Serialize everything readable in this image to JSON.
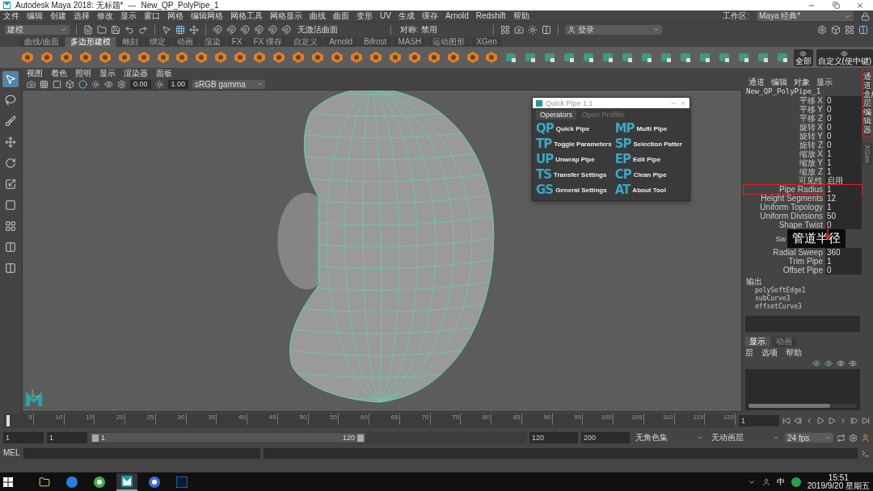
{
  "title_bar": {
    "app_title": "Autodesk Maya 2018: 无标题*",
    "separator": "---",
    "scene": "New_QP_PolyPipe_1"
  },
  "menu_bar": {
    "items": [
      "文件",
      "编辑",
      "创建",
      "选择",
      "修改",
      "显示",
      "窗口",
      "网格",
      "编辑网格",
      "网格工具",
      "网格显示",
      "曲线",
      "曲面",
      "变形",
      "UV",
      "生成",
      "缓存",
      "Arnold",
      "Redshift",
      "帮助"
    ],
    "workspace_label": "工作区:",
    "workspace": "Maya 经典*"
  },
  "status_line": {
    "mode": "建模",
    "surface": "无激活曲面",
    "symmetry": "对称: 禁用",
    "login": "登录"
  },
  "shelf": {
    "tabs": [
      {
        "label": "曲线/曲面",
        "selected": false
      },
      {
        "label": "多边形建模",
        "selected": true
      },
      {
        "label": "雕刻",
        "selected": false
      },
      {
        "label": "绑定",
        "selected": false
      },
      {
        "label": "动画",
        "selected": false
      },
      {
        "label": "渲染",
        "selected": false
      },
      {
        "label": "FX",
        "selected": false
      },
      {
        "label": "FX 缓存",
        "selected": false
      },
      {
        "label": "自定义",
        "selected": false
      },
      {
        "label": "Arnold",
        "selected": false
      },
      {
        "label": "Bifrost",
        "selected": false
      },
      {
        "label": "MASH",
        "selected": false
      },
      {
        "label": "运动图形",
        "selected": false
      },
      {
        "label": "XGen",
        "selected": false
      }
    ],
    "labeled_tools": [
      "全部",
      "自定义(使中键)"
    ]
  },
  "viewport": {
    "menu": [
      "视图",
      "着色",
      "照明",
      "显示",
      "渲染器",
      "面板"
    ],
    "exposure": "0.00",
    "gamma": "1.00",
    "color_space": "sRGB gamma"
  },
  "quick_pipe": {
    "title": "Quick Pipe 1.1",
    "tabs": [
      {
        "label": "Operators",
        "selected": true
      },
      {
        "label": "Open Profiler",
        "selected": false
      }
    ],
    "operators": [
      {
        "abbr": "QP",
        "label": "Quick Pipe"
      },
      {
        "abbr": "MP",
        "label": "Multi Pipe"
      },
      {
        "abbr": "TP",
        "label": "Toggle Parameters"
      },
      {
        "abbr": "SP",
        "label": "Selection Patter"
      },
      {
        "abbr": "UP",
        "label": "Unwrap Pipe"
      },
      {
        "abbr": "EP",
        "label": "Edit Pipe"
      },
      {
        "abbr": "TS",
        "label": "Transfer Settings"
      },
      {
        "abbr": "CP",
        "label": "Clean Pipe"
      },
      {
        "abbr": "GS",
        "label": "General Settings"
      },
      {
        "abbr": "AT",
        "label": "About Tool"
      }
    ]
  },
  "channel_box": {
    "menu": [
      "通道",
      "编辑",
      "对象",
      "显示"
    ],
    "object": "New_QP_PolyPipe_1",
    "attributes": [
      {
        "name": "平移 X",
        "value": "0",
        "highlighted": false
      },
      {
        "name": "平移 Y",
        "value": "0",
        "highlighted": false
      },
      {
        "name": "平移 Z",
        "value": "0",
        "highlighted": false
      },
      {
        "name": "旋转 X",
        "value": "0",
        "highlighted": false
      },
      {
        "name": "旋转 Y",
        "value": "0",
        "highlighted": false
      },
      {
        "name": "旋转 Z",
        "value": "0",
        "highlighted": false
      },
      {
        "name": "缩放 X",
        "value": "1",
        "highlighted": false
      },
      {
        "name": "缩放 Y",
        "value": "1",
        "highlighted": false
      },
      {
        "name": "缩放 Z",
        "value": "1",
        "highlighted": false
      },
      {
        "name": "可见性",
        "value": "启用",
        "highlighted": false
      },
      {
        "name": "Pipe Radius",
        "value": "1",
        "highlighted": true
      },
      {
        "name": "Height Segments",
        "value": "12",
        "highlighted": false
      },
      {
        "name": "Uniform Topology",
        "value": "1",
        "highlighted": false
      },
      {
        "name": "Uniform Divisions",
        "value": "50",
        "highlighted": false
      },
      {
        "name": "Shape Twist",
        "value": "0",
        "highlighted": false
      }
    ],
    "covered_fragment": "Sw",
    "callout": "管道半径",
    "attributes_after": [
      {
        "name": "Radial Sweep",
        "value": "360",
        "highlighted": false
      },
      {
        "name": "Trim Pipe",
        "value": "1",
        "highlighted": false
      },
      {
        "name": "Offset Pipe",
        "value": "0",
        "highlighted": false
      }
    ],
    "outputs_label": "输出",
    "outputs": [
      "polySoftEdge1",
      "subCurve3",
      "offsetCurve3"
    ]
  },
  "side_tabs": [
    {
      "label": "通道盒/层编辑器",
      "highlighted": true
    },
    {
      "label": "XGen",
      "highlighted": false
    }
  ],
  "layer_editor": {
    "tabs": [
      {
        "label": "显示",
        "selected": true
      },
      {
        "label": "动画",
        "selected": false
      }
    ],
    "menu": [
      "层",
      "选项",
      "帮助"
    ]
  },
  "time_slider": {
    "ticks": [
      "5",
      "10",
      "15",
      "20",
      "25",
      "30",
      "35",
      "40",
      "45",
      "50",
      "55",
      "60",
      "65",
      "70",
      "75",
      "80",
      "85",
      "90",
      "95",
      "100",
      "105",
      "110",
      "115",
      "120"
    ],
    "current": "1"
  },
  "range_slider": {
    "start": "1",
    "playback_start": "1",
    "range_start": "1",
    "range_end": "120",
    "playback_end": "120",
    "end": "200",
    "character_set": "无角色集",
    "anim_layer": "无动画层",
    "fps": "24 fps"
  },
  "command_line": {
    "language": "MEL"
  },
  "taskbar": {
    "input_method": "中",
    "time": "15:51",
    "date": "2019/9/20 星期五"
  }
}
